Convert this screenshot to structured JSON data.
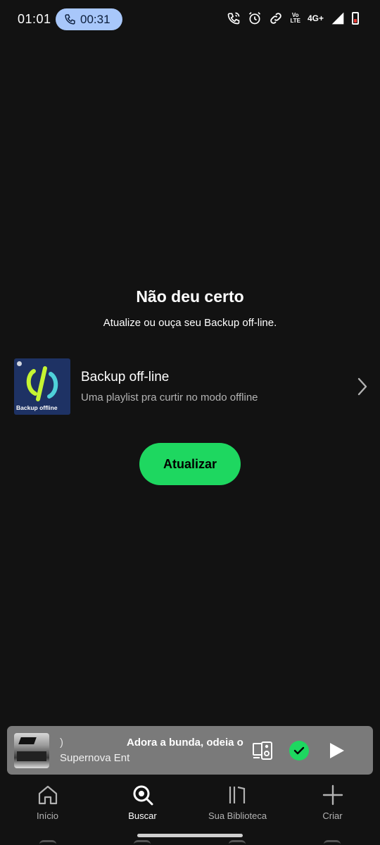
{
  "status_bar": {
    "time": "01:01",
    "call_timer": "00:31",
    "volte_top": "Vo",
    "volte_bottom": "LTE",
    "network": "4G+"
  },
  "main": {
    "title": "Não deu certo",
    "subtitle": "Atualize ou ouça seu Backup off-line.",
    "playlist": {
      "cover_label": "Backup offline",
      "title": "Backup off-line",
      "description": "Uma playlist pra curtir no modo offline"
    },
    "update_button": "Atualizar"
  },
  "mini_player": {
    "prev_fragment": ")",
    "song_title": "Adora a bunda, odeia o",
    "artist": "Supernova Ent",
    "liked": true
  },
  "bottom_nav": {
    "items": [
      {
        "label": "Início",
        "icon": "home-icon",
        "active": false
      },
      {
        "label": "Buscar",
        "icon": "search-icon",
        "active": true
      },
      {
        "label": "Sua Biblioteca",
        "icon": "library-icon",
        "active": false
      },
      {
        "label": "Criar",
        "icon": "plus-icon",
        "active": false
      }
    ]
  },
  "colors": {
    "background": "#121212",
    "accent_green": "#1ed760",
    "call_pill": "#a8c7fa",
    "mini_player_bg": "#7a7a7a",
    "cover_bg": "#1e3264"
  }
}
